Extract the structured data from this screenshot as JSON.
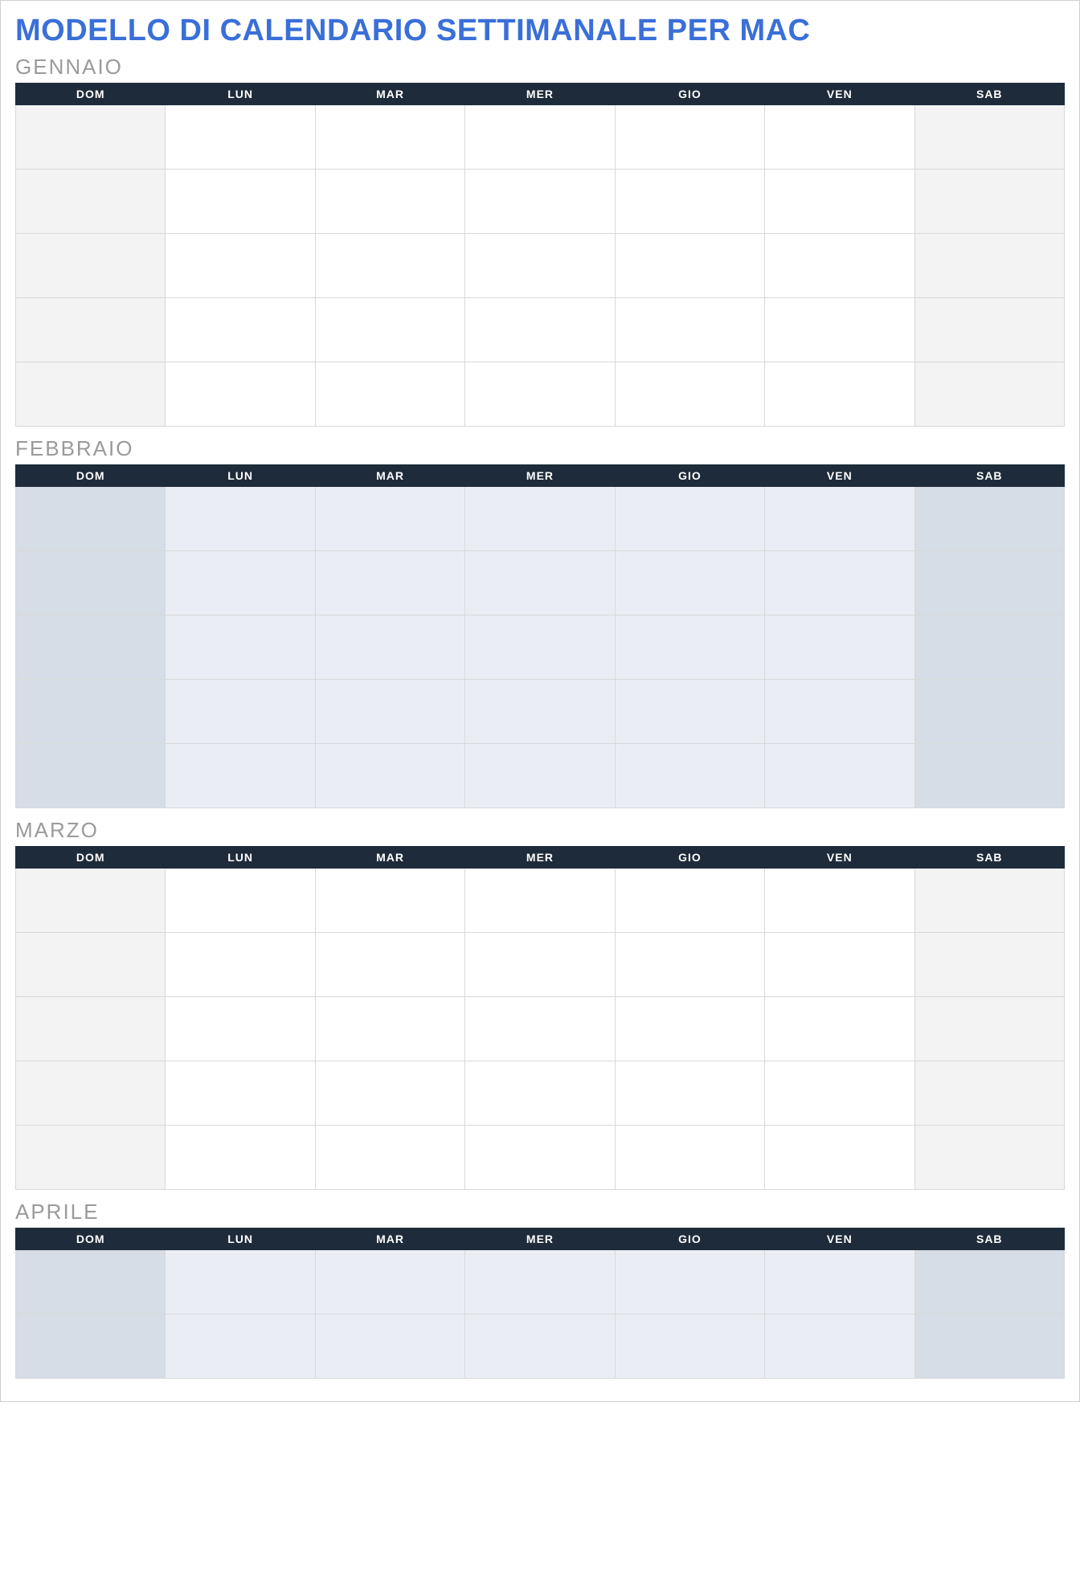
{
  "title": "MODELLO DI CALENDARIO SETTIMANALE PER MAC",
  "day_headers": [
    "DOM",
    "LUN",
    "MAR",
    "MER",
    "GIO",
    "VEN",
    "SAB"
  ],
  "months": [
    {
      "name": "GENNAIO",
      "style": "light",
      "weeks": 5
    },
    {
      "name": "FEBBRAIO",
      "style": "blue",
      "weeks": 5
    },
    {
      "name": "MARZO",
      "style": "light",
      "weeks": 5
    },
    {
      "name": "APRILE",
      "style": "blue",
      "weeks": 2
    }
  ]
}
